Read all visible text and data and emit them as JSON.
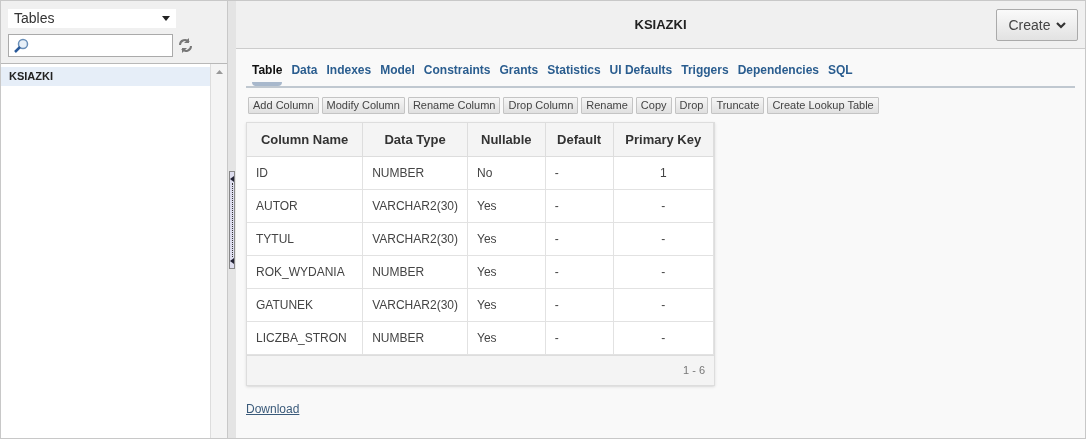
{
  "sidebar": {
    "object_type": "Tables",
    "items": [
      {
        "label": "KSIAZKI",
        "selected": true
      }
    ]
  },
  "header": {
    "title": "KSIAZKI",
    "create_button": "Create"
  },
  "tabs": [
    {
      "label": "Table",
      "selected": true
    },
    {
      "label": "Data",
      "selected": false
    },
    {
      "label": "Indexes",
      "selected": false
    },
    {
      "label": "Model",
      "selected": false
    },
    {
      "label": "Constraints",
      "selected": false
    },
    {
      "label": "Grants",
      "selected": false
    },
    {
      "label": "Statistics",
      "selected": false
    },
    {
      "label": "UI Defaults",
      "selected": false
    },
    {
      "label": "Triggers",
      "selected": false
    },
    {
      "label": "Dependencies",
      "selected": false
    },
    {
      "label": "SQL",
      "selected": false
    }
  ],
  "actions": [
    "Add Column",
    "Modify Column",
    "Rename Column",
    "Drop Column",
    "Rename",
    "Copy",
    "Drop",
    "Truncate",
    "Create Lookup Table"
  ],
  "table": {
    "columns": [
      "Column Name",
      "Data Type",
      "Nullable",
      "Default",
      "Primary Key"
    ],
    "rows": [
      [
        "ID",
        "NUMBER",
        "No",
        "-",
        "1"
      ],
      [
        "AUTOR",
        "VARCHAR2(30)",
        "Yes",
        "-",
        "-"
      ],
      [
        "TYTUL",
        "VARCHAR2(30)",
        "Yes",
        "-",
        "-"
      ],
      [
        "ROK_WYDANIA",
        "NUMBER",
        "Yes",
        "-",
        "-"
      ],
      [
        "GATUNEK",
        "VARCHAR2(30)",
        "Yes",
        "-",
        "-"
      ],
      [
        "LICZBA_STRON",
        "NUMBER",
        "Yes",
        "-",
        "-"
      ]
    ],
    "pagination": "1 - 6"
  },
  "download_link": "Download"
}
